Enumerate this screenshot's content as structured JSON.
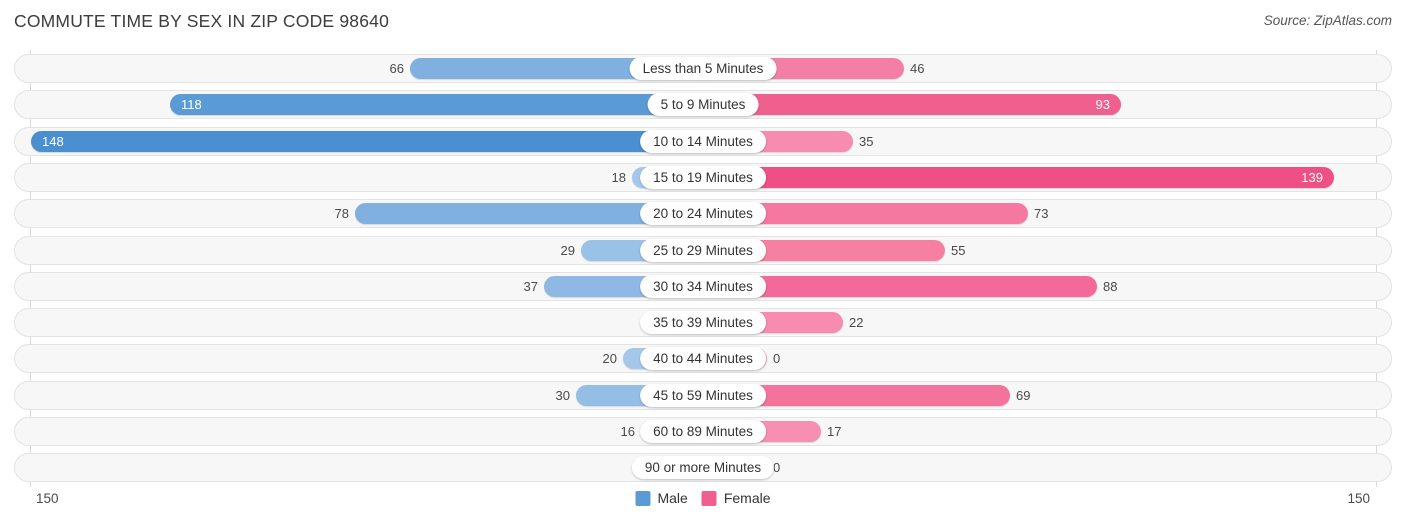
{
  "header": {
    "title": "COMMUTE TIME BY SEX IN ZIP CODE 98640",
    "source": "Source: ZipAtlas.com"
  },
  "legend": {
    "male_label": "Male",
    "female_label": "Female",
    "male_color": "#5b9bd5",
    "female_color": "#f0608f"
  },
  "axis": {
    "left_tick": "150",
    "right_tick": "150",
    "max": 150
  },
  "chart_data": {
    "type": "bar",
    "orientation": "horizontal-diverging",
    "title": "COMMUTE TIME BY SEX IN ZIP CODE 98640",
    "xlabel": "",
    "ylabel": "",
    "xlim": [
      150,
      150
    ],
    "grid": false,
    "legend_position": "bottom-center",
    "categories": [
      "Less than 5 Minutes",
      "5 to 9 Minutes",
      "10 to 14 Minutes",
      "15 to 19 Minutes",
      "20 to 24 Minutes",
      "25 to 29 Minutes",
      "30 to 34 Minutes",
      "35 to 39 Minutes",
      "40 to 44 Minutes",
      "45 to 59 Minutes",
      "60 to 89 Minutes",
      "90 or more Minutes"
    ],
    "series": [
      {
        "name": "Male",
        "values": [
          66,
          118,
          148,
          18,
          78,
          29,
          37,
          0,
          20,
          30,
          16,
          0
        ]
      },
      {
        "name": "Female",
        "values": [
          46,
          93,
          35,
          139,
          73,
          55,
          88,
          22,
          0,
          69,
          17,
          0
        ]
      }
    ]
  },
  "rows": [
    {
      "label": "Less than 5 Minutes",
      "male": "66",
      "female": "46",
      "male_w": 305,
      "female_w": 213,
      "male_color": "#7fb0e0",
      "female_color": "#f47fa6",
      "male_inside": false,
      "female_inside": false
    },
    {
      "label": "5 to 9 Minutes",
      "male": "118",
      "female": "93",
      "male_w": 545,
      "female_w": 430,
      "male_color": "#5b9bd5",
      "female_color": "#f0608f",
      "male_inside": true,
      "female_inside": true
    },
    {
      "label": "10 to 14 Minutes",
      "male": "148",
      "female": "35",
      "male_w": 684,
      "female_w": 162,
      "male_color": "#4a8fd0",
      "female_color": "#f78cb0",
      "male_inside": true,
      "female_inside": false
    },
    {
      "label": "15 to 19 Minutes",
      "male": "18",
      "female": "139",
      "male_w": 83,
      "female_w": 643,
      "male_color": "#a5c8ea",
      "female_color": "#ee4f85",
      "male_inside": false,
      "female_inside": true
    },
    {
      "label": "20 to 24 Minutes",
      "male": "78",
      "female": "73",
      "male_w": 360,
      "female_w": 337,
      "male_color": "#7fb0e0",
      "female_color": "#f4789f",
      "male_inside": false,
      "female_inside": false
    },
    {
      "label": "25 to 29 Minutes",
      "male": "29",
      "female": "55",
      "male_w": 134,
      "female_w": 254,
      "male_color": "#9ac1e7",
      "female_color": "#f5809f",
      "male_inside": false,
      "female_inside": false
    },
    {
      "label": "30 to 34 Minutes",
      "male": "37",
      "female": "88",
      "male_w": 171,
      "female_w": 406,
      "male_color": "#8fb9e4",
      "female_color": "#f2699a",
      "male_inside": false,
      "female_inside": false
    },
    {
      "label": "35 to 39 Minutes",
      "male": "0",
      "female": "22",
      "male_w": 50,
      "female_w": 152,
      "male_color": "#a9cbec",
      "female_color": "#f78cb0",
      "male_inside": false,
      "female_inside": false
    },
    {
      "label": "40 to 44 Minutes",
      "male": "20",
      "female": "0",
      "male_w": 92,
      "female_w": 76,
      "male_color": "#a5c8ea",
      "female_color": "#f9a6c3",
      "male_inside": false,
      "female_inside": false
    },
    {
      "label": "45 to 59 Minutes",
      "male": "30",
      "female": "69",
      "male_w": 139,
      "female_w": 319,
      "male_color": "#95bee6",
      "female_color": "#f3739d",
      "male_inside": false,
      "female_inside": false
    },
    {
      "label": "60 to 89 Minutes",
      "male": "16",
      "female": "17",
      "male_w": 74,
      "female_w": 130,
      "male_color": "#a9cbec",
      "female_color": "#f78fb2",
      "male_inside": false,
      "female_inside": false
    },
    {
      "label": "90 or more Minutes",
      "male": "0",
      "female": "0",
      "male_w": 50,
      "female_w": 76,
      "male_color": "#aacdee",
      "female_color": "#f9a6c3",
      "male_inside": false,
      "female_inside": false
    }
  ]
}
